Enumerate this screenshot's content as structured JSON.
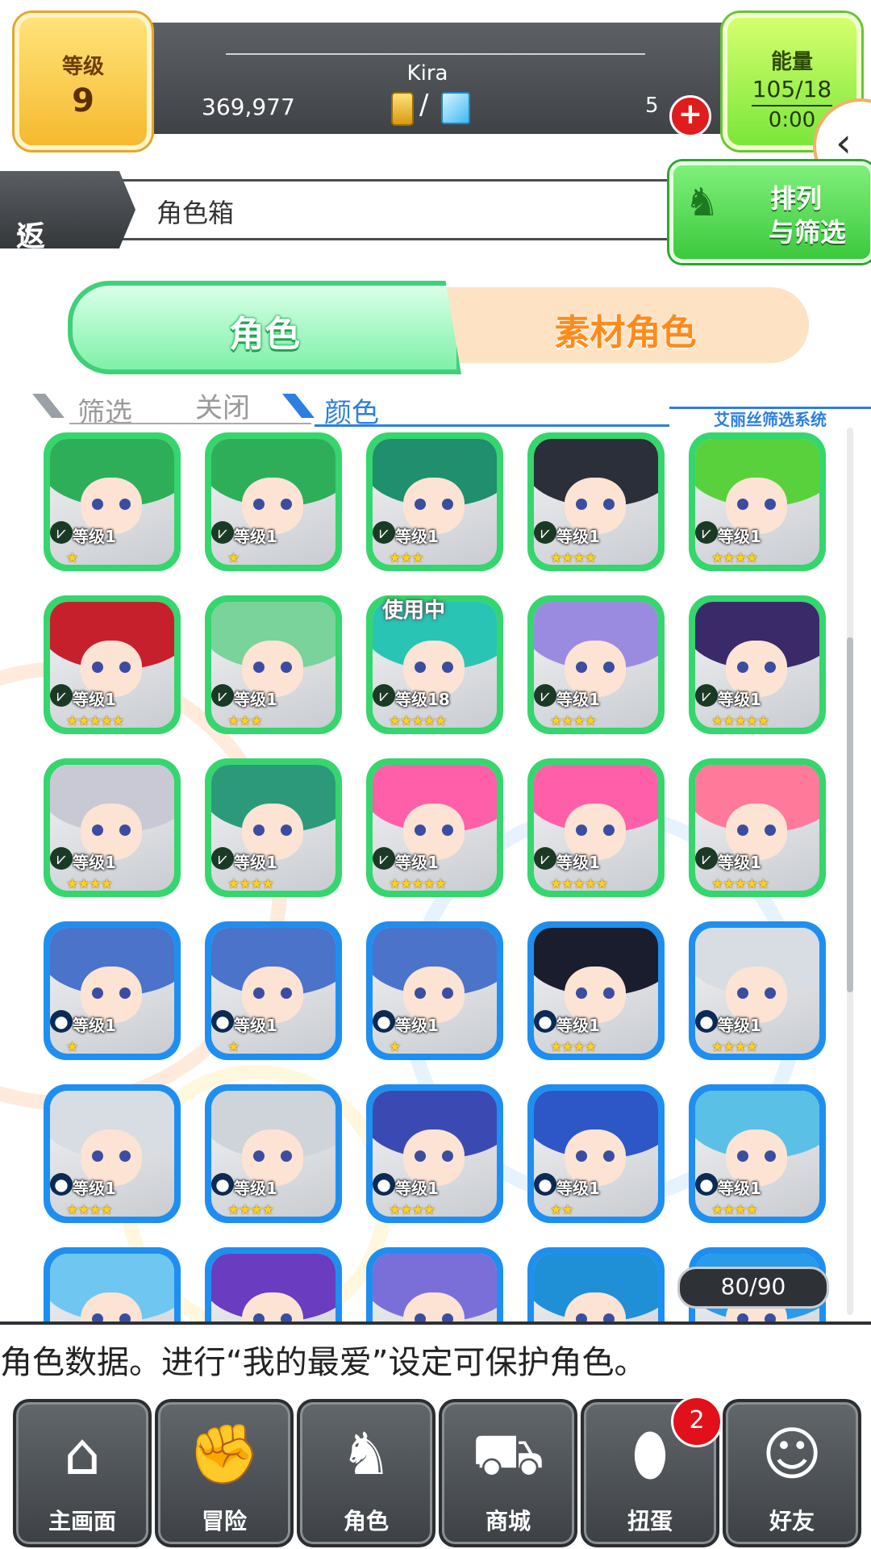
{
  "header": {
    "level_label": "等级",
    "level_value": "9",
    "player_name": "Kira",
    "coins": "369,977",
    "currency_separator": "/",
    "stones": "5",
    "energy_label": "能量",
    "energy_value": "105/18",
    "energy_timer": "0:00"
  },
  "nav_bar": {
    "back_label": "返回",
    "title": "角色箱",
    "sort_label_1": "排列",
    "sort_label_2": "与筛选"
  },
  "tabs": {
    "characters": "角色",
    "materials": "素材角色"
  },
  "filter": {
    "filter_label": "筛选",
    "close_label": "关闭",
    "color_label": "颜色",
    "system_label": "艾丽丝筛选系统"
  },
  "grid": {
    "in_use_label": "使用中",
    "count": "80/90",
    "cells": [
      {
        "level": "等级1",
        "stars": "★",
        "color": "green",
        "hair": "#2fae59"
      },
      {
        "level": "等级1",
        "stars": "★",
        "color": "green",
        "hair": "#2fae59"
      },
      {
        "level": "等级1",
        "stars": "★★★",
        "color": "green",
        "hair": "#1f8f6d"
      },
      {
        "level": "等级1",
        "stars": "★★★★",
        "color": "green",
        "hair": "#2a2f3a"
      },
      {
        "level": "等级1",
        "stars": "★★★★",
        "color": "green",
        "hair": "#59d13c"
      },
      {
        "level": "等级1",
        "stars": "★★★★★",
        "color": "green",
        "hair": "#c6202d"
      },
      {
        "level": "等级1",
        "stars": "★★★",
        "color": "green",
        "hair": "#7ad39a"
      },
      {
        "level": "等级18",
        "stars": "★★★★★",
        "color": "green",
        "hair": "#2ac4b4",
        "in_use": true
      },
      {
        "level": "等级1",
        "stars": "★★★★",
        "color": "green",
        "hair": "#9b8be0"
      },
      {
        "level": "等级1",
        "stars": "★★★★★",
        "color": "green",
        "hair": "#3a2a6a"
      },
      {
        "level": "等级1",
        "stars": "★★★★",
        "color": "green",
        "hair": "#c9c9d6"
      },
      {
        "level": "等级1",
        "stars": "★★★★",
        "color": "green",
        "hair": "#2c9a7a"
      },
      {
        "level": "等级1",
        "stars": "★★★★★",
        "color": "green",
        "hair": "#ff5fa8"
      },
      {
        "level": "等级1",
        "stars": "★★★★★",
        "color": "green",
        "hair": "#ff5fa8"
      },
      {
        "level": "等级1",
        "stars": "★★★★★",
        "color": "green",
        "hair": "#ff7a9a"
      },
      {
        "level": "等级1",
        "stars": "★",
        "color": "blue",
        "hair": "#4a73c9"
      },
      {
        "level": "等级1",
        "stars": "★",
        "color": "blue",
        "hair": "#4a73c9"
      },
      {
        "level": "等级1",
        "stars": "★",
        "color": "blue",
        "hair": "#4a73c9"
      },
      {
        "level": "等级1",
        "stars": "★★★★",
        "color": "blue",
        "hair": "#1a1d2e"
      },
      {
        "level": "等级1",
        "stars": "★★★★",
        "color": "blue",
        "hair": "#d8dde3"
      },
      {
        "level": "等级1",
        "stars": "★★★★",
        "color": "blue",
        "hair": "#d8dde3"
      },
      {
        "level": "等级1",
        "stars": "★★★★",
        "color": "blue",
        "hair": "#cfd3da"
      },
      {
        "level": "等级1",
        "stars": "★★★★",
        "color": "blue",
        "hair": "#3b4ab2"
      },
      {
        "level": "等级1",
        "stars": "★★",
        "color": "blue",
        "hair": "#2d56c7"
      },
      {
        "level": "等级1",
        "stars": "★★★★",
        "color": "blue",
        "hair": "#5ac0e6"
      },
      {
        "level": "",
        "stars": "",
        "color": "blue",
        "hair": "#6fc6f0"
      },
      {
        "level": "",
        "stars": "",
        "color": "blue",
        "hair": "#6a3cc0"
      },
      {
        "level": "",
        "stars": "",
        "color": "blue",
        "hair": "#7a6fd8"
      },
      {
        "level": "",
        "stars": "",
        "color": "blue",
        "hair": "#1f8fd6"
      },
      {
        "level": "",
        "stars": "",
        "color": "blue",
        "hair": "#2a9be8"
      }
    ]
  },
  "ticker": {
    "text": "角色数据。进行“我的最爱”设定可保护角色。"
  },
  "bottom_nav": {
    "items": [
      {
        "label": "主画面",
        "icon": "home-icon"
      },
      {
        "label": "冒险",
        "icon": "handshake-icon"
      },
      {
        "label": "角色",
        "icon": "rabbit-icon"
      },
      {
        "label": "商城",
        "icon": "cart-icon"
      },
      {
        "label": "扭蛋",
        "icon": "egg-icon"
      },
      {
        "label": "好友",
        "icon": "friends-icon"
      }
    ],
    "gacha_badge": "2"
  },
  "colors": {
    "green_frame": "#35d66d",
    "blue_frame": "#1e8ff0",
    "accent_blue": "#2b7fe0",
    "material_tab_text": "#ff8a1a"
  }
}
